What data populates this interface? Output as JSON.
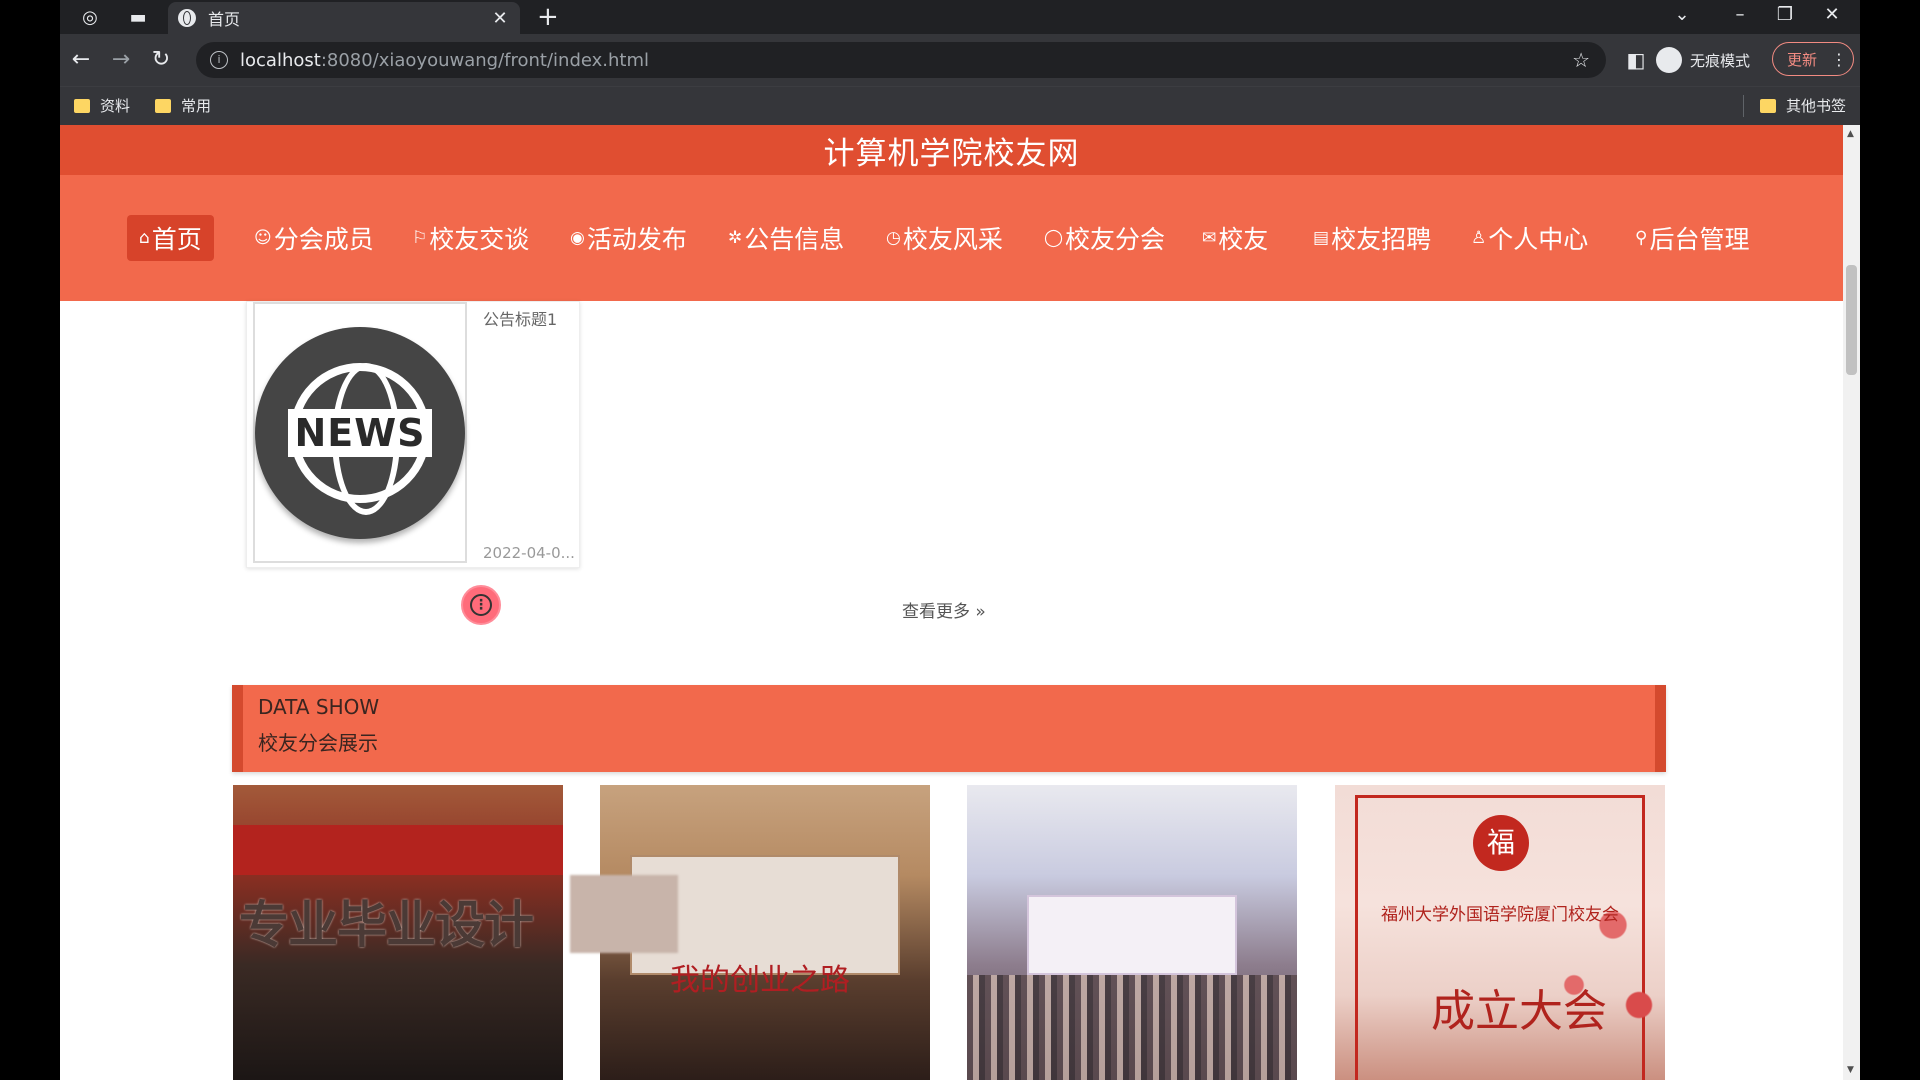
{
  "browser": {
    "tab_title": "首页",
    "url_host": "localhost",
    "url_rest": ":8080/xiaoyouwang/front/index.html",
    "incognito_label": "无痕模式",
    "update_label": "更新",
    "bookmarks": [
      "资料",
      "常用"
    ],
    "other_bookmarks": "其他书签"
  },
  "site": {
    "title": "计算机学院校友网",
    "nav": [
      {
        "label": "首页",
        "icon": "home-icon",
        "glyph": "⌂"
      },
      {
        "label": "分会成员",
        "icon": "members-icon",
        "glyph": "☺"
      },
      {
        "label": "校友交谈",
        "icon": "flag-icon",
        "glyph": "⚐"
      },
      {
        "label": "活动发布",
        "icon": "palette-icon",
        "glyph": "◉"
      },
      {
        "label": "公告信息",
        "icon": "gear-icon",
        "glyph": "✲"
      },
      {
        "label": "校友风采",
        "icon": "clock-icon",
        "glyph": "◷"
      },
      {
        "label": "校友分会",
        "icon": "circle-icon",
        "glyph": "◯"
      },
      {
        "label": "校友",
        "icon": "mail-icon",
        "glyph": "✉"
      },
      {
        "label": "校友招聘",
        "icon": "document-icon",
        "glyph": "▤"
      },
      {
        "label": "个人中心",
        "icon": "user-icon",
        "glyph": "♙"
      },
      {
        "label": "后台管理",
        "icon": "link-icon",
        "glyph": "⚲"
      }
    ]
  },
  "news": {
    "image_text": "NEWS",
    "title": "公告标题1",
    "date": "2022-04-0..."
  },
  "more_link": "查看更多",
  "data_show": {
    "title_en": "DATA SHOW",
    "title_cn": "校友分会展示"
  },
  "photos": {
    "p1_caption": "专业毕业设计",
    "p2_text": "我的创业之路",
    "p4_line1": "福州大学外国语学院厦门校友会",
    "p4_big": "成立大会",
    "p4_seal": "福"
  },
  "colors": {
    "brand": "#f2694c",
    "brand_dark": "#e04e31"
  }
}
